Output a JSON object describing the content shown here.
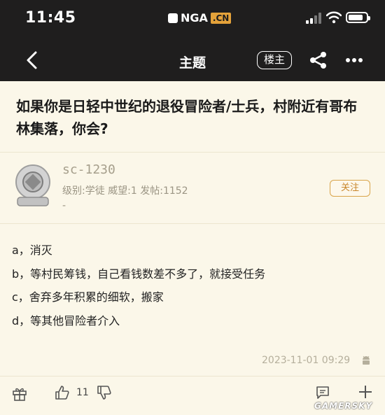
{
  "status_bar": {
    "time": "11:45",
    "logo_main": "NGA",
    "logo_suffix": ".CN"
  },
  "nav": {
    "title": "主题",
    "op_button": "楼主",
    "back_icon": "chevron-left-icon",
    "share_icon": "share-icon",
    "more_icon": "more-dots-icon"
  },
  "post": {
    "title": "如果你是日轻中世纪的退役冒险者/士兵，村附近有哥布林集落，你会?",
    "author": {
      "name": "sc-1230",
      "meta": "级别:学徒  威望:1  发帖:1152",
      "extra": "-",
      "follow_label": "关注"
    },
    "options": [
      "a，消灭",
      "b，等村民筹钱，自己看钱数差不多了，就接受任务",
      "c，舍弃多年积累的细软，搬家",
      "d，等其他冒险者介入"
    ],
    "timestamp": "2023-11-01 09:29"
  },
  "footer": {
    "like_count": "11"
  },
  "watermark": "GAMERSKY",
  "colors": {
    "topbar": "#1f1e1e",
    "background": "#fbf7e9",
    "accent": "#d9a44a"
  }
}
